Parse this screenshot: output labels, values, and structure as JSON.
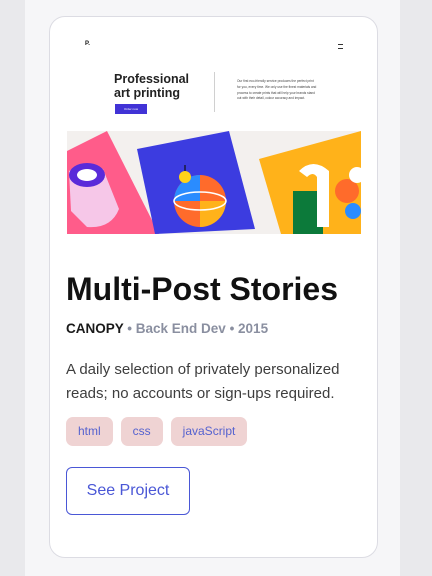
{
  "preview": {
    "logo": "P.",
    "headline": "Professional\nart printing",
    "button_label": "Order now",
    "description": "Our first eco-friendly service produces the perfect print for you, every time. We only use the finest materials and process to create prints that will help your brands stand out with their detail, colour accuracy and impact.",
    "art_colors": [
      "#ff5c8a",
      "#3c3ce0",
      "#ffb21a",
      "#0c7a3a",
      "#ff6b2b"
    ]
  },
  "project": {
    "title": "Multi-Post Stories",
    "client": "CANOPY",
    "role": "• Back End Dev",
    "year": "• 2015",
    "description": "A daily selection of privately personalized reads; no accounts or sign-ups required.",
    "tags": [
      "html",
      "css",
      "javaScript"
    ],
    "cta_label": "See Project"
  },
  "colors": {
    "accent": "#4a57d6",
    "tag_bg": "#efd3d3",
    "meta_gray": "#8a8fa0"
  }
}
